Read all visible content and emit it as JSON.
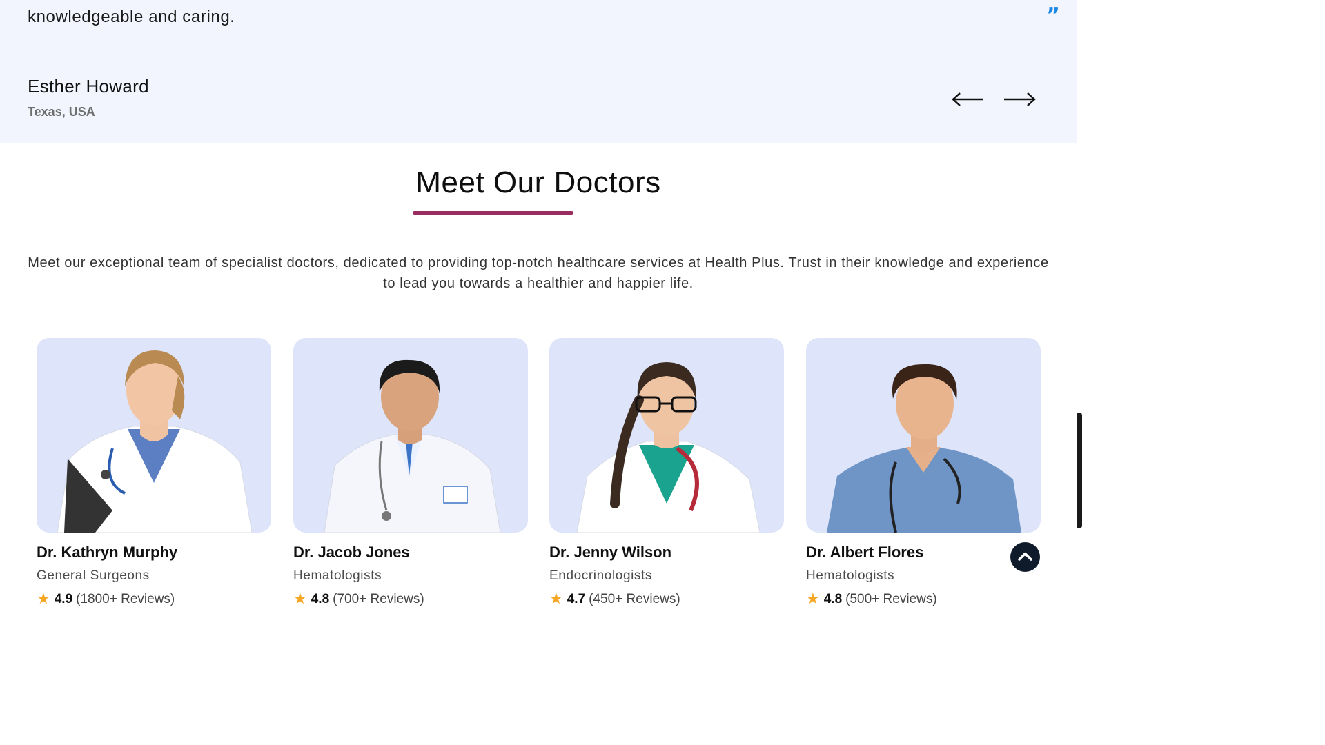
{
  "testimonial": {
    "quote_fragment": "knowledgeable and caring.",
    "quote_mark": "”",
    "author_name": "Esther Howard",
    "author_location": "Texas, USA",
    "prev_icon": "arrow-left-icon",
    "next_icon": "arrow-right-icon"
  },
  "doctors_section": {
    "title": "Meet Our Doctors",
    "description": "Meet our exceptional team of specialist doctors, dedicated to providing top-notch healthcare services at Health Plus. Trust in their knowledge and experience to lead you towards a healthier and happier life.",
    "accent_color": "#9b2c5f",
    "card_bg_color": "#dee4fa",
    "star_color": "#f5a623",
    "doctors": [
      {
        "name": "Dr. Kathryn Murphy",
        "specialty": "General Surgeons",
        "star": "★",
        "rating": "4.9",
        "reviews": "(1800+ Reviews)"
      },
      {
        "name": "Dr. Jacob Jones",
        "specialty": "Hematologists",
        "star": "★",
        "rating": "4.8",
        "reviews": "(700+ Reviews)"
      },
      {
        "name": "Dr. Jenny Wilson",
        "specialty": "Endocrinologists",
        "star": "★",
        "rating": "4.7",
        "reviews": "(450+ Reviews)"
      },
      {
        "name": "Dr. Albert Flores",
        "specialty": "Hematologists",
        "star": "★",
        "rating": "4.8",
        "reviews": "(500+ Reviews)"
      }
    ]
  },
  "back_to_top_icon": "chevron-up-icon"
}
